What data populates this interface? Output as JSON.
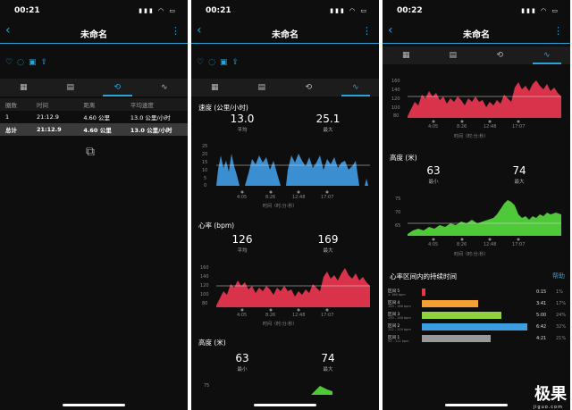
{
  "screen1": {
    "time": "00:21",
    "title": "未命名",
    "table": {
      "headers": [
        "圈数",
        "时间",
        "距离",
        "平均速度"
      ],
      "rows": [
        [
          "1",
          "21:12.9",
          "4.60 公里",
          "13.0 公里/小时"
        ],
        [
          "总计",
          "21:12.9",
          "4.60 公里",
          "13.0 公里/小时"
        ]
      ]
    }
  },
  "screen2": {
    "time": "00:21",
    "title": "未命名",
    "speed": {
      "label": "速度 (公里/小时)",
      "avg": "13.0",
      "avg_label": "平均",
      "max": "25.1",
      "max_label": "最大"
    },
    "hr": {
      "label": "心率 (bpm)",
      "avg": "126",
      "avg_label": "平均",
      "max": "169",
      "max_label": "最大"
    },
    "alt": {
      "label": "高度 (米)",
      "min": "63",
      "min_label": "最小",
      "max": "74",
      "max_label": "最大"
    },
    "xaxis_title": "时间（时:分:秒）",
    "xticks": [
      "4:05",
      "8:26",
      "12:48",
      "17:07"
    ],
    "speed_yticks": [
      "25",
      "20",
      "15",
      "10",
      "5",
      "0"
    ],
    "hr_yticks": [
      "160",
      "140",
      "120",
      "100",
      "80"
    ],
    "alt_ytick": "75"
  },
  "screen3": {
    "time": "00:22",
    "title": "未命名",
    "hr_yticks": [
      "160",
      "140",
      "120",
      "100",
      "80"
    ],
    "alt": {
      "label": "高度 (米)",
      "min": "63",
      "min_label": "最小",
      "max": "74",
      "max_label": "最大"
    },
    "alt_yticks": [
      "75",
      "70",
      "65"
    ],
    "xaxis_title": "时间（时:分:秒）",
    "xticks": [
      "4:05",
      "8:26",
      "12:48",
      "17:07"
    ],
    "zones_title": "心率区间内的持续时间",
    "help": "帮助",
    "zones": [
      {
        "name": "区间 5",
        "range": "> 166 bpm",
        "time": "0:15",
        "pct": "1%",
        "frac": 0.01,
        "color": "#e8364a"
      },
      {
        "name": "区间 4",
        "range": "149 - 166 bpm",
        "time": "3:41",
        "pct": "17%",
        "frac": 0.17,
        "color": "#f5a033"
      },
      {
        "name": "区间 3",
        "range": "130 - 148 bpm",
        "time": "5:00",
        "pct": "24%",
        "frac": 0.24,
        "color": "#8fd13f"
      },
      {
        "name": "区间 2",
        "range": "112 - 129 bpm",
        "time": "6:42",
        "pct": "32%",
        "frac": 0.32,
        "color": "#3a9ee0"
      },
      {
        "name": "区间 1",
        "range": "93 - 111 bpm",
        "time": "4:21",
        "pct": "21%",
        "frac": 0.21,
        "color": "#999999"
      }
    ]
  },
  "watermark": {
    "brand": "极果",
    "url": "jiguo.com"
  }
}
